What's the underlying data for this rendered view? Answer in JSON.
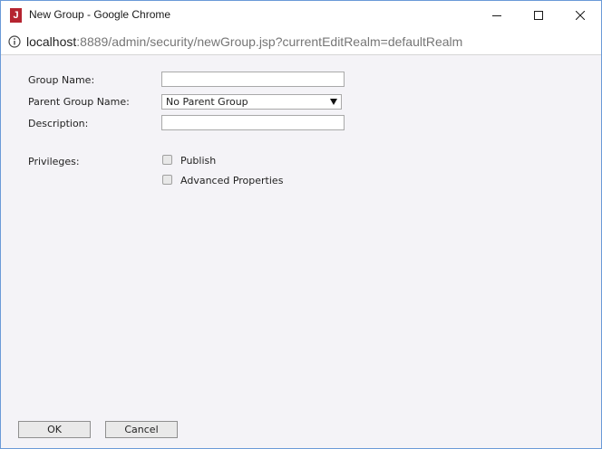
{
  "window": {
    "app_icon_letter": "J",
    "title": "New Group - Google Chrome",
    "controls": {
      "minimize_icon": "minimize-icon",
      "maximize_icon": "maximize-icon",
      "close_icon": "close-icon"
    }
  },
  "address_bar": {
    "info_icon": "info-icon",
    "host": "localhost",
    "rest": ":8889/admin/security/newGroup.jsp?currentEditRealm=defaultRealm"
  },
  "form": {
    "group_name_label": "Group Name:",
    "group_name_value": "",
    "parent_group_label": "Parent Group Name:",
    "parent_group_selected": "No Parent Group",
    "description_label": "Description:",
    "description_value": "",
    "privileges_label": "Privileges:",
    "privileges": [
      {
        "label": "Publish",
        "checked": false
      },
      {
        "label": "Advanced Properties",
        "checked": false
      }
    ]
  },
  "buttons": {
    "ok_label": "OK",
    "cancel_label": "Cancel"
  },
  "colors": {
    "window_border": "#6a9ad8",
    "content_background": "#f4f3f7",
    "app_icon": "#b52430"
  }
}
